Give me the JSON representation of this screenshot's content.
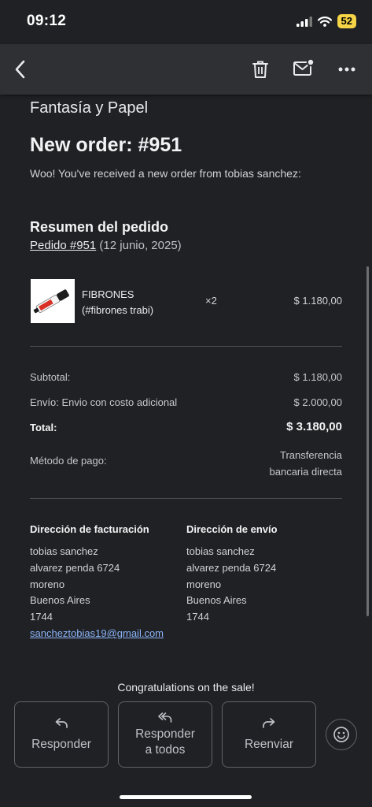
{
  "status_bar": {
    "time": "09:12",
    "battery": "52"
  },
  "toolbar": {
    "back_icon": "chevron-left-icon",
    "delete_icon": "trash-icon",
    "mark_unread_icon": "mail-dot-icon",
    "more_icon": "more-horizontal-icon"
  },
  "email": {
    "store_name": "Fantasía y Papel",
    "heading": "New order: #951",
    "intro": "Woo! You've received a new order from tobias sanchez:",
    "summary_title": "Resumen del pedido",
    "order_link": "Pedido #951",
    "order_date": "(12 junio, 2025)",
    "items": [
      {
        "name": "FIBRONES",
        "sku": "(#fibrones trabi)",
        "qty": "×2",
        "price": "$ 1.180,00"
      }
    ],
    "totals": [
      {
        "label": "Subtotal:",
        "value": "$ 1.180,00"
      },
      {
        "label": "Envío: Envio con costo adicional",
        "value": "$ 2.000,00"
      },
      {
        "label": "Total:",
        "value": "$ 3.180,00"
      },
      {
        "label": "Método de pago:",
        "value_line1": "Transferencia",
        "value_line2": "bancaria directa"
      }
    ],
    "billing": {
      "title": "Dirección de facturación",
      "name": "tobias sanchez",
      "street": "alvarez penda 6724",
      "city": "moreno",
      "province": "Buenos Aires",
      "zip": "1744",
      "email": "sancheztobias19@gmail.com"
    },
    "shipping": {
      "title": "Dirección de envío",
      "name": "tobias sanchez",
      "street": "alvarez penda 6724",
      "city": "moreno",
      "province": "Buenos Aires",
      "zip": "1744"
    },
    "closing": "Congratulations on the sale!"
  },
  "actions": {
    "reply": "Responder",
    "reply_all_line1": "Responder",
    "reply_all_line2": "a todos",
    "forward": "Reenviar",
    "emoji_icon": "emoji-reaction-icon"
  },
  "colors": {
    "background": "#202124",
    "toolbar": "#2f3033",
    "link": "#8ab4f8",
    "battery": "#f5d547"
  }
}
